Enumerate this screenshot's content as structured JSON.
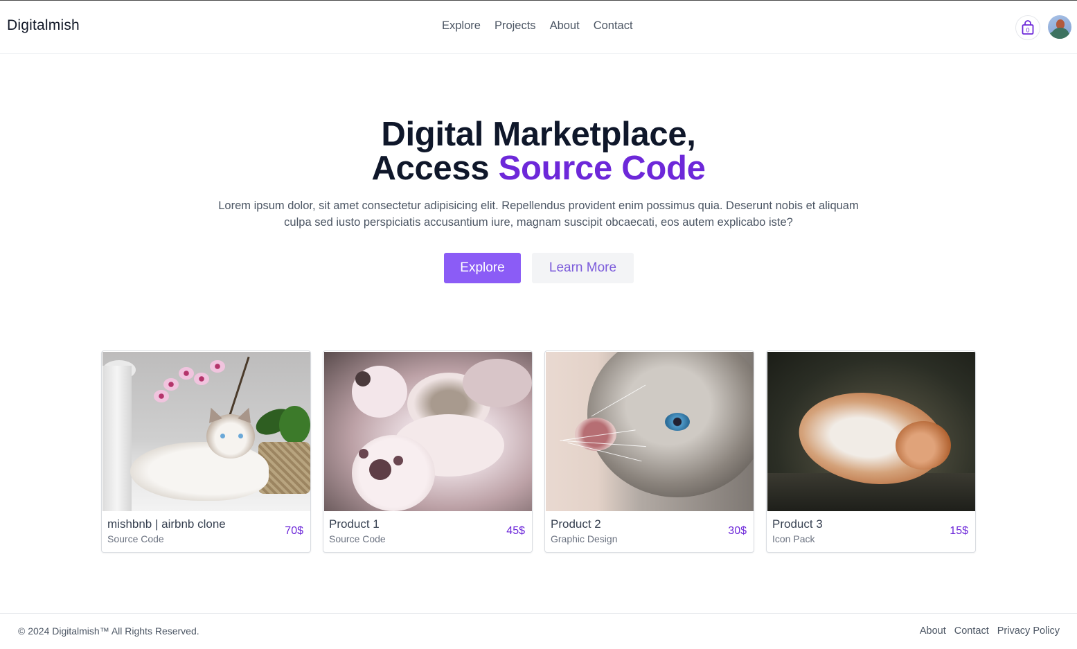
{
  "header": {
    "brand": "Digitalmish",
    "nav": [
      {
        "label": "Explore"
      },
      {
        "label": "Projects"
      },
      {
        "label": "About"
      },
      {
        "label": "Contact"
      }
    ],
    "cart_icon": "shopping-bag-icon",
    "cart_count": "0",
    "avatar_icon": "user-avatar"
  },
  "hero": {
    "title_line1": "Digital Marketplace,",
    "title_line2_plain": "Access ",
    "title_line2_accent": "Source Code",
    "description": "Lorem ipsum dolor, sit amet consectetur adipisicing elit. Repellendus provident enim possimus quia. Deserunt nobis et aliquam culpa sed iusto perspiciatis accusantium iure, magnam suscipit obcaecati, eos autem explicabo iste?",
    "primary_button": "Explore",
    "secondary_button": "Learn More"
  },
  "products": [
    {
      "name": "mishbnb | airbnb clone",
      "category": "Source Code",
      "price": "70$",
      "image": "ragdoll-cat-with-orchids"
    },
    {
      "name": "Product 1",
      "category": "Source Code",
      "price": "45$",
      "image": "kitten-paws-up"
    },
    {
      "name": "Product 2",
      "category": "Graphic Design",
      "price": "30$",
      "image": "grey-cat-looking-up"
    },
    {
      "name": "Product 3",
      "category": "Icon Pack",
      "price": "15$",
      "image": "ginger-cat-sleeping"
    }
  ],
  "footer": {
    "copyright": "© 2024 Digitalmish™ All Rights Reserved.",
    "links": [
      {
        "label": "About"
      },
      {
        "label": "Contact"
      },
      {
        "label": "Privacy Policy"
      }
    ]
  },
  "colors": {
    "accent": "#6d28d9",
    "primary_button": "#8b5cf6",
    "secondary_button_bg": "#f3f4f6",
    "price": "#6d28d9"
  }
}
